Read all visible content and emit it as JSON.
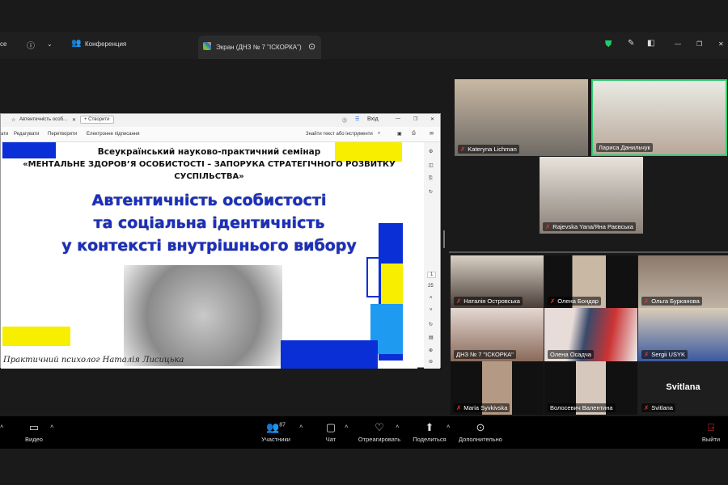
{
  "topbar": {
    "left_fragment": "ce",
    "info_icon": "info",
    "conference_label": "Конференция",
    "screen_tab_label": "Экран (ДНЗ № 7 \"ІСКОРКА\")"
  },
  "browser": {
    "tab_title": "Автентичність особ...",
    "new_button": "+ Створити",
    "signin": "Вхід",
    "menu": [
      "ати",
      "Редагувати",
      "Перетворити",
      "Електронне підписання"
    ],
    "search": "Знайти текст або інструменти",
    "page_current": "1",
    "page_total": "25"
  },
  "slide": {
    "subtitle1": "Всеукраїнський науково-практичний семінар",
    "subtitle2": "«МЕНТАЛЬНЕ ЗДОРОВ’Я ОСОБИСТОСТІ – ЗАПОРУКА СТРАТЕГІЧНОГО РОЗВИТКУ",
    "subtitle3": "СУСПІЛЬСТВА»",
    "title1": "Автентичність особистості",
    "title2": "та соціальна ідентичність",
    "title3": "у контексті внутрішнього вибору",
    "author": "Практичний психолог Наталія Лисицька",
    "colors": {
      "blue": "#0a2fd6",
      "yellow": "#f7ee00"
    }
  },
  "participants": [
    {
      "name": "Kateryna Lichman",
      "muted": true
    },
    {
      "name": "Лариса Данильчук",
      "muted": false
    },
    {
      "name": "Rajevska Yana/Яна Раєвська",
      "muted": true
    },
    {
      "name": "Наталія Островська",
      "muted": true
    },
    {
      "name": "Олена Бондар",
      "muted": true
    },
    {
      "name": "Ольга Бурканова",
      "muted": true
    },
    {
      "name": "ДНЗ № 7 \"ІСКОРКА\"",
      "muted": false
    },
    {
      "name": "Олена Осадча",
      "muted": false
    },
    {
      "name": "Sergii USYK",
      "muted": true
    },
    {
      "name": "Maria  Syvkivska",
      "muted": true
    },
    {
      "name": "Волосевич Валентина",
      "muted": false
    },
    {
      "name": "Svitlana",
      "muted": true
    }
  ],
  "svitlana_placeholder": "Svitlana",
  "toolbar": {
    "video": "Видео",
    "participants": "Участники",
    "participants_count": "87",
    "chat": "Чат",
    "react": "Отреагировать",
    "share": "Поделиться",
    "more": "Дополнительно",
    "leave": "Выйти"
  }
}
